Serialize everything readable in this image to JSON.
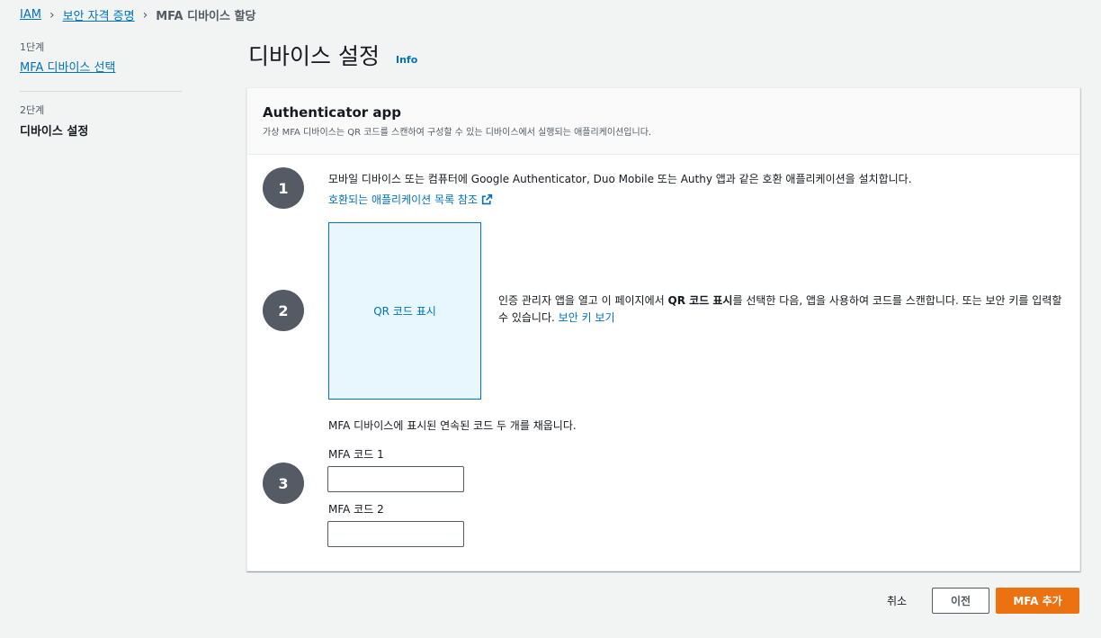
{
  "breadcrumb": {
    "items": [
      "IAM",
      "보안 자격 증명"
    ],
    "current": "MFA 디바이스 할당"
  },
  "steps": {
    "step1_num": "1단계",
    "step1_label": "MFA 디바이스 선택",
    "step2_num": "2단계",
    "step2_label": "디바이스 설정"
  },
  "page": {
    "title": "디바이스 설정",
    "info": "Info"
  },
  "panel": {
    "title": "Authenticator app",
    "description": "가상 MFA 디바이스는 QR 코드를 스캔하여 구성할 수 있는 디바이스에서 실행되는 애플리케이션입니다."
  },
  "step1": {
    "number": "1",
    "text": "모바일 디바이스 또는 컴퓨터에 Google Authenticator, Duo Mobile 또는 Authy 앱과 같은 호환 애플리케이션을 설치합니다.",
    "link": "호환되는 애플리케이션 목록 참조"
  },
  "step2": {
    "number": "2",
    "qr_button": "QR 코드 표시",
    "text_before": "인증 관리자 앱을 열고 이 페이지에서 ",
    "text_bold": "QR 코드 표시",
    "text_after": "를 선택한 다음, 앱을 사용하여 코드를 스캔합니다. 또는 보안 키를 입력할 수 있습니다. ",
    "link": "보안 키 보기"
  },
  "step3": {
    "number": "3",
    "text": "MFA 디바이스에 표시된 연속된 코드 두 개를 채웁니다.",
    "code1_label": "MFA 코드 1",
    "code1_value": "",
    "code2_label": "MFA 코드 2",
    "code2_value": ""
  },
  "footer": {
    "cancel": "취소",
    "previous": "이전",
    "add_mfa": "MFA 추가"
  },
  "colors": {
    "link": "#0073bb",
    "primary_button": "#ec7211",
    "step_circle": "#545b64",
    "qr_box_bg": "#e7f7fd"
  },
  "icons": [
    "chevron-right-icon",
    "external-link-icon"
  ]
}
